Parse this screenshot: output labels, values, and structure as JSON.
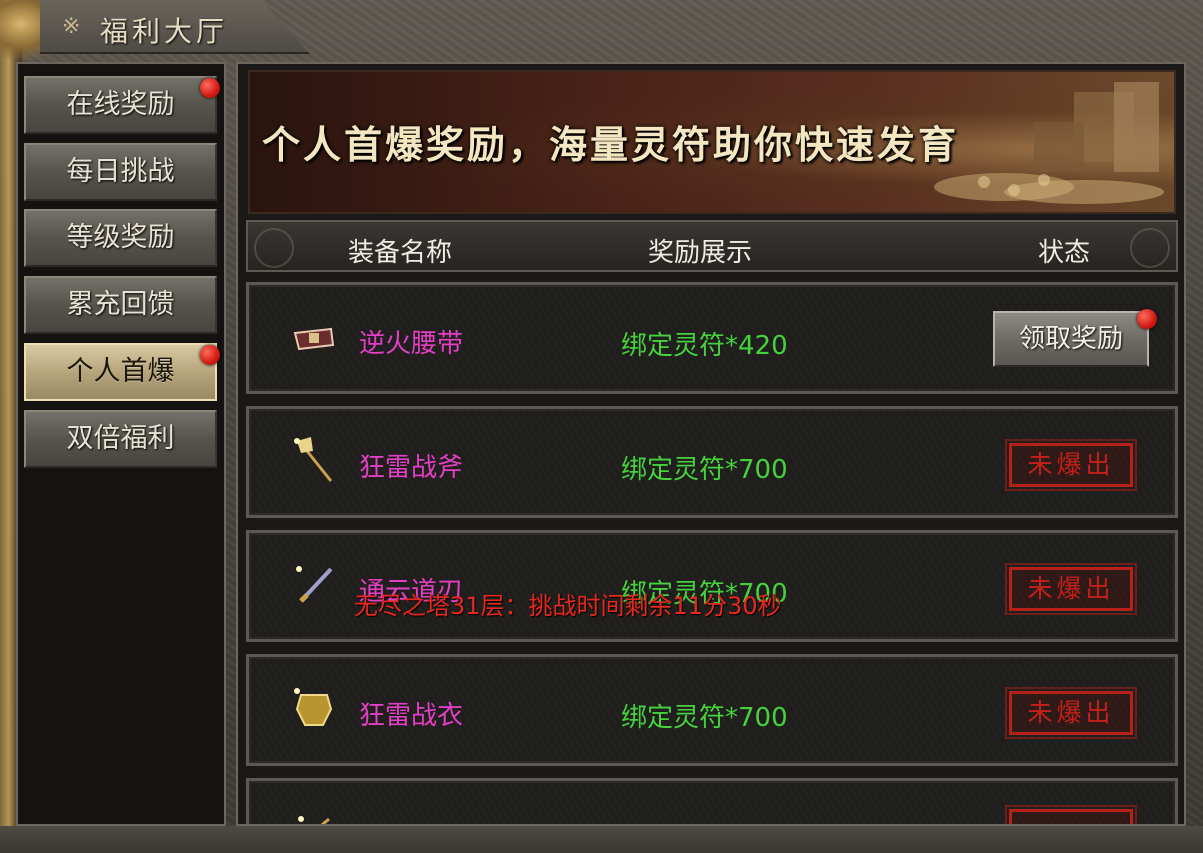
{
  "window": {
    "title": "福利大厅",
    "title_deco": "※"
  },
  "sidebar": {
    "items": [
      {
        "label": "在线奖励",
        "active": false,
        "notify": true
      },
      {
        "label": "每日挑战",
        "active": false,
        "notify": false
      },
      {
        "label": "等级奖励",
        "active": false,
        "notify": false
      },
      {
        "label": "累充回馈",
        "active": false,
        "notify": false
      },
      {
        "label": "个人首爆",
        "active": true,
        "notify": true
      },
      {
        "label": "双倍福利",
        "active": false,
        "notify": false
      }
    ]
  },
  "banner": {
    "text": "个人首爆奖励，海量灵符助你快速发育"
  },
  "table": {
    "headers": {
      "name": "装备名称",
      "reward": "奖励展示",
      "status": "状态"
    },
    "rows": [
      {
        "name": "逆火腰带",
        "reward": "绑定灵符*420",
        "status": "领取奖励",
        "status_type": "claim",
        "notify": true,
        "icon": "belt-icon"
      },
      {
        "name": "狂雷战斧",
        "reward": "绑定灵符*700",
        "status": "未爆出",
        "status_type": "not-dropped",
        "icon": "axe-icon"
      },
      {
        "name": "通云道刃",
        "reward": "绑定灵符*700",
        "status": "未爆出",
        "status_type": "not-dropped",
        "icon": "blade-icon"
      },
      {
        "name": "狂雷战衣",
        "reward": "绑定灵符*700",
        "status": "未爆出",
        "status_type": "not-dropped",
        "icon": "armor-icon"
      },
      {
        "name": "",
        "reward": "",
        "status": "",
        "status_type": "not-dropped",
        "icon": "item-icon"
      }
    ]
  },
  "system_message": {
    "text": "无尽之塔31层：挑战时间剩余11分30秒",
    "color": "#e8271d"
  },
  "colors": {
    "item_name": "#e23fc4",
    "reward": "#45d23c",
    "stamp_red": "#c42019",
    "notify_dot": "#d11a12"
  }
}
